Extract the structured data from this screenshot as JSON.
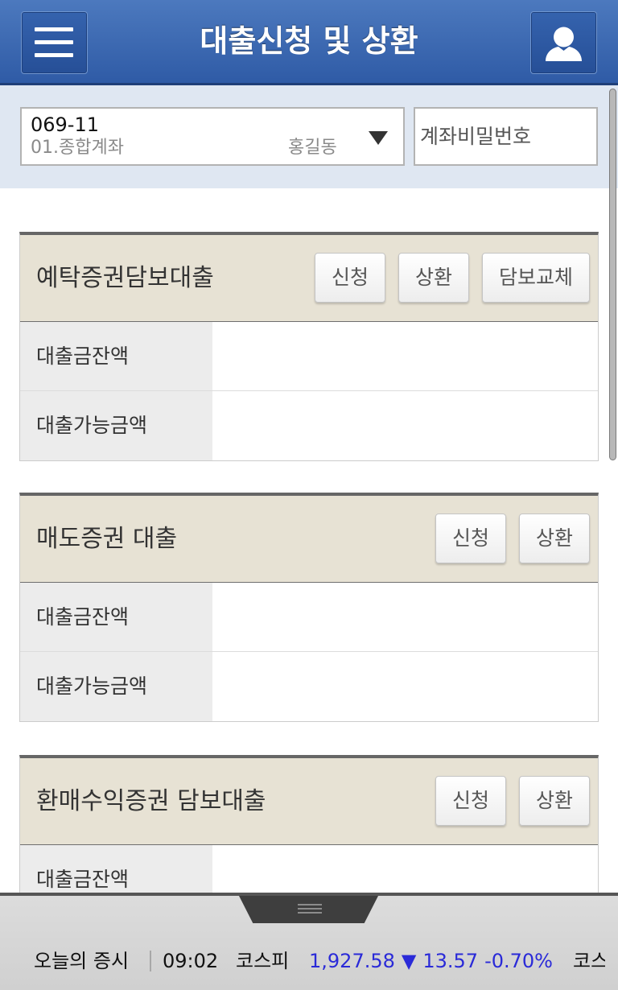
{
  "header": {
    "title": "대출신청 및 상환",
    "menu_icon": "menu-icon",
    "user_icon": "user-icon"
  },
  "account": {
    "number": "069-11",
    "type": "01.종합계좌",
    "owner": "홍길동",
    "dropdown_icon": "caret-down-icon",
    "password_placeholder": "계좌비밀번호"
  },
  "sections": [
    {
      "title": "예탁증권담보대출",
      "buttons": [
        "신청",
        "상환",
        "담보교체"
      ],
      "rows": [
        {
          "label": "대출금잔액"
        },
        {
          "label": "대출가능금액"
        }
      ]
    },
    {
      "title": "매도증권 대출",
      "buttons": [
        "신청",
        "상환"
      ],
      "rows": [
        {
          "label": "대출금잔액"
        },
        {
          "label": "대출가능금액"
        }
      ]
    },
    {
      "title": "환매수익증권 담보대출",
      "buttons": [
        "신청",
        "상환"
      ],
      "rows": [
        {
          "label": "대출금잔액"
        }
      ]
    }
  ],
  "ticker": {
    "label": "오늘의 증시",
    "time": "09:02",
    "index_name": "코스피",
    "index_value": "1,927.58",
    "direction": "▼",
    "change": "13.57",
    "change_pct": "-0.70%",
    "next_index_name": "코스"
  },
  "colors": {
    "header_blue": "#3866b0",
    "account_panel_bg": "#dfe7f2",
    "section_header_bg": "#e7e2d4",
    "ticker_blue": "#2a2ad8"
  }
}
